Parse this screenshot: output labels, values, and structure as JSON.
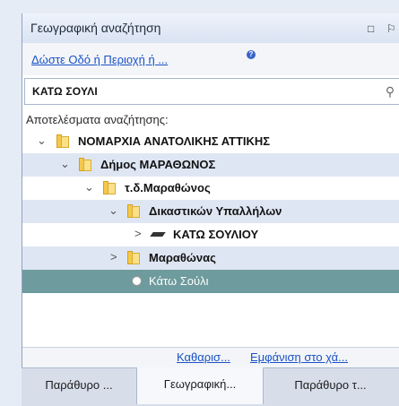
{
  "panel": {
    "title": "Γεωγραφική αναζήτηση",
    "link_text": "Δώστε Οδό ή Περιοχή ή ...",
    "help_icon": "?",
    "search_value": "ΚΑΤΩ ΣΟΥΛΙ",
    "results_label": "Αποτελέσματα αναζήτησης:"
  },
  "tree": [
    {
      "label": "ΝΟΜΑΡΧΙΑ ΑΝΑΤΟΛΙΚΗΣ ΑΤΤΙΚΗΣ",
      "expander": "⌄",
      "icon": "folder-icon"
    },
    {
      "label": "Δήμος ΜΑΡΑΘΩΝΟΣ",
      "expander": "⌄",
      "icon": "folder-icon"
    },
    {
      "label": "τ.δ.Μαραθώνος",
      "expander": "⌄",
      "icon": "folder-icon"
    },
    {
      "label": "Δικαστικών Υπαλλήλων",
      "expander": "⌄",
      "icon": "folder-icon"
    },
    {
      "label": "ΚΑΤΩ ΣΟΥΛΙΟΥ",
      "expander": ">",
      "icon": "road-icon"
    },
    {
      "label": "Μαραθώνας",
      "expander": ">",
      "icon": "folder-icon"
    },
    {
      "label": "Κάτω Σούλι",
      "expander": "",
      "icon": "circle-icon",
      "selected": true
    }
  ],
  "footer": {
    "clear_link": "Καθαρισ...",
    "show_link": "Εμφάνιση στο χά..."
  },
  "tabs": [
    "Παράθυρο ...",
    "Γεωγραφική...",
    "Παράθυρο τ..."
  ],
  "colors": {
    "accent": "#1a52c6",
    "selected_row": "#6e9b9d",
    "highlight_row": "#dfe6f3"
  }
}
